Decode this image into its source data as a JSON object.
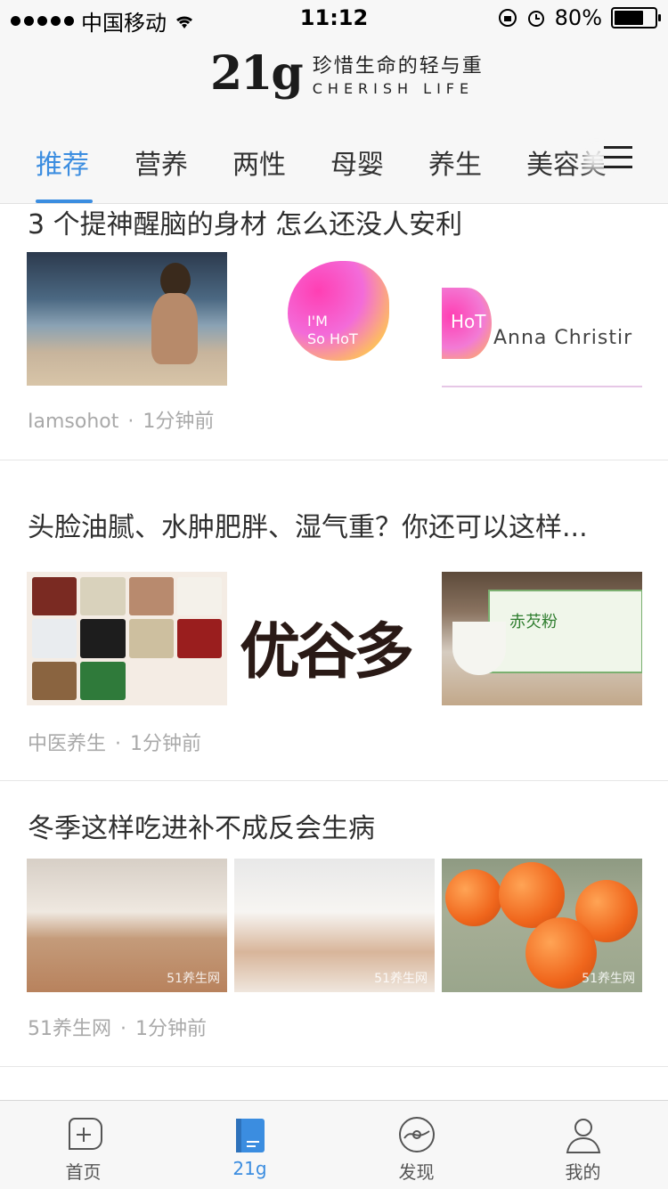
{
  "status_bar": {
    "carrier": "中国移动",
    "time": "11:12",
    "battery": "80%",
    "battery_level": 0.8
  },
  "header": {
    "logo_mark": "21g",
    "slogan_cn": "珍惜生命的轻与重",
    "slogan_en": "CHERISH LIFE"
  },
  "tabs": [
    {
      "label": "推荐",
      "active": true
    },
    {
      "label": "营养"
    },
    {
      "label": "两性"
    },
    {
      "label": "母婴"
    },
    {
      "label": "养生"
    },
    {
      "label": "美容美"
    }
  ],
  "articles": [
    {
      "title": "3 个提神醒脑的身材 怎么还没人安利",
      "source": "Iamsohot",
      "time": "1分钟前",
      "images": [
        {
          "type": "photo-beach-woman"
        },
        {
          "type": "logo-imsohot",
          "text_a": "I'M",
          "text_b": "So HoT"
        },
        {
          "type": "logo-anna",
          "text_a": "HoT",
          "text_b": "Anna Christir"
        }
      ]
    },
    {
      "title": "头脸油腻、水肿肥胖、湿气重？你还可以这样...",
      "source": "中医养生",
      "time": "1分钟前",
      "images": [
        {
          "type": "grains-chart"
        },
        {
          "type": "brand-logo",
          "text_a": "优谷多"
        },
        {
          "type": "product-photo",
          "text_a": "赤芡粉"
        }
      ]
    },
    {
      "title": "冬季这样吃进补不成反会生病",
      "source": "51养生网",
      "time": "1分钟前",
      "images": [
        {
          "type": "photo-man-sleeping",
          "watermark": "51养生网"
        },
        {
          "type": "photo-couple",
          "watermark": "51养生网"
        },
        {
          "type": "photo-persimmons",
          "watermark": "51养生网"
        }
      ]
    }
  ],
  "tabbar": [
    {
      "label": "首页",
      "icon": "add-square-icon"
    },
    {
      "label": "21g",
      "icon": "book-icon",
      "active": true
    },
    {
      "label": "发现",
      "icon": "compass-icon"
    },
    {
      "label": "我的",
      "icon": "user-icon"
    }
  ],
  "colors": {
    "accent": "#3b8de0",
    "text": "#2f2f2f",
    "muted": "#a9a9a9",
    "bar_bg": "#f7f7f7"
  }
}
